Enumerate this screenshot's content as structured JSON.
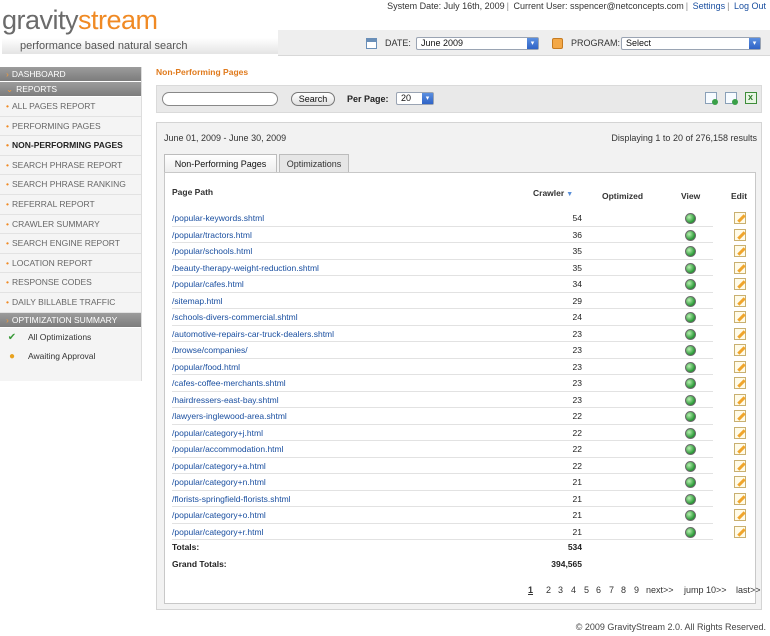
{
  "header": {
    "logo_part1": "gravity",
    "logo_part2": "stream",
    "tagline": "performance based natural search",
    "system_date": "System Date: July 16th, 2009",
    "current_user": "Current User: sspencer@netconcepts.com",
    "settings": "Settings",
    "logout": "Log Out"
  },
  "filters": {
    "date_label": "DATE:",
    "date_value": "June 2009",
    "program_label": "PROGRAM:",
    "program_value": "Select",
    "icons": [
      "calendar-icon",
      "program-icon"
    ]
  },
  "sidebar": {
    "dashboard": "DASHBOARD",
    "reports": "REPORTS",
    "items": [
      "ALL PAGES REPORT",
      "PERFORMING PAGES",
      "NON-PERFORMING PAGES",
      "SEARCH PHRASE REPORT",
      "SEARCH PHRASE RANKING",
      "REFERRAL REPORT",
      "CRAWLER SUMMARY",
      "SEARCH ENGINE REPORT",
      "LOCATION REPORT",
      "RESPONSE CODES",
      "DAILY BILLABLE TRAFFIC"
    ],
    "active_item": "NON-PERFORMING PAGES",
    "optimization_summary": "OPTIMIZATION SUMMARY",
    "sub_items": [
      "All Optimizations",
      "Awaiting Approval"
    ]
  },
  "main": {
    "title": "Non-Performing Pages",
    "search_placeholder": "",
    "search_button": "Search",
    "per_page_label": "Per Page:",
    "per_page_value": "20",
    "date_range": "June 01, 2009 - June 30, 2009",
    "displaying": "Displaying 1 to 20 of 276,158 results",
    "tabs": [
      "Non-Performing Pages",
      "Optimizations"
    ],
    "columns": {
      "path": "Page Path",
      "crawler": "Crawler",
      "optimized": "Optimized",
      "view": "View",
      "edit": "Edit"
    },
    "rows": [
      {
        "path": "/popular-keywords.shtml",
        "crawler": "54"
      },
      {
        "path": "/popular/tractors.html",
        "crawler": "36"
      },
      {
        "path": "/popular/schools.html",
        "crawler": "35"
      },
      {
        "path": "/beauty-therapy-weight-reduction.shtml",
        "crawler": "35"
      },
      {
        "path": "/popular/cafes.html",
        "crawler": "34"
      },
      {
        "path": "/sitemap.html",
        "crawler": "29"
      },
      {
        "path": "/schools-divers-commercial.shtml",
        "crawler": "24"
      },
      {
        "path": "/automotive-repairs-car-truck-dealers.shtml",
        "crawler": "23"
      },
      {
        "path": "/browse/companies/",
        "crawler": "23"
      },
      {
        "path": "/popular/food.html",
        "crawler": "23"
      },
      {
        "path": "/cafes-coffee-merchants.shtml",
        "crawler": "23"
      },
      {
        "path": "/hairdressers-east-bay.shtml",
        "crawler": "23"
      },
      {
        "path": "/lawyers-inglewood-area.shtml",
        "crawler": "22"
      },
      {
        "path": "/popular/category+j.html",
        "crawler": "22"
      },
      {
        "path": "/popular/accommodation.html",
        "crawler": "22"
      },
      {
        "path": "/popular/category+a.html",
        "crawler": "22"
      },
      {
        "path": "/popular/category+n.html",
        "crawler": "21"
      },
      {
        "path": "/florists-springfield-florists.shtml",
        "crawler": "21"
      },
      {
        "path": "/popular/category+o.html",
        "crawler": "21"
      },
      {
        "path": "/popular/category+r.html",
        "crawler": "21"
      }
    ],
    "totals_label": "Totals:",
    "totals_value": "534",
    "grand_totals_label": "Grand Totals:",
    "grand_totals_value": "394,565"
  },
  "pager": {
    "pages": [
      "1",
      "2",
      "3",
      "4",
      "5",
      "6",
      "7",
      "8",
      "9"
    ],
    "current": "1",
    "next": "next>>",
    "jump": "jump 10>>",
    "last": "last>>"
  },
  "footer": "© 2009 GravityStream 2.0. All Rights Reserved."
}
